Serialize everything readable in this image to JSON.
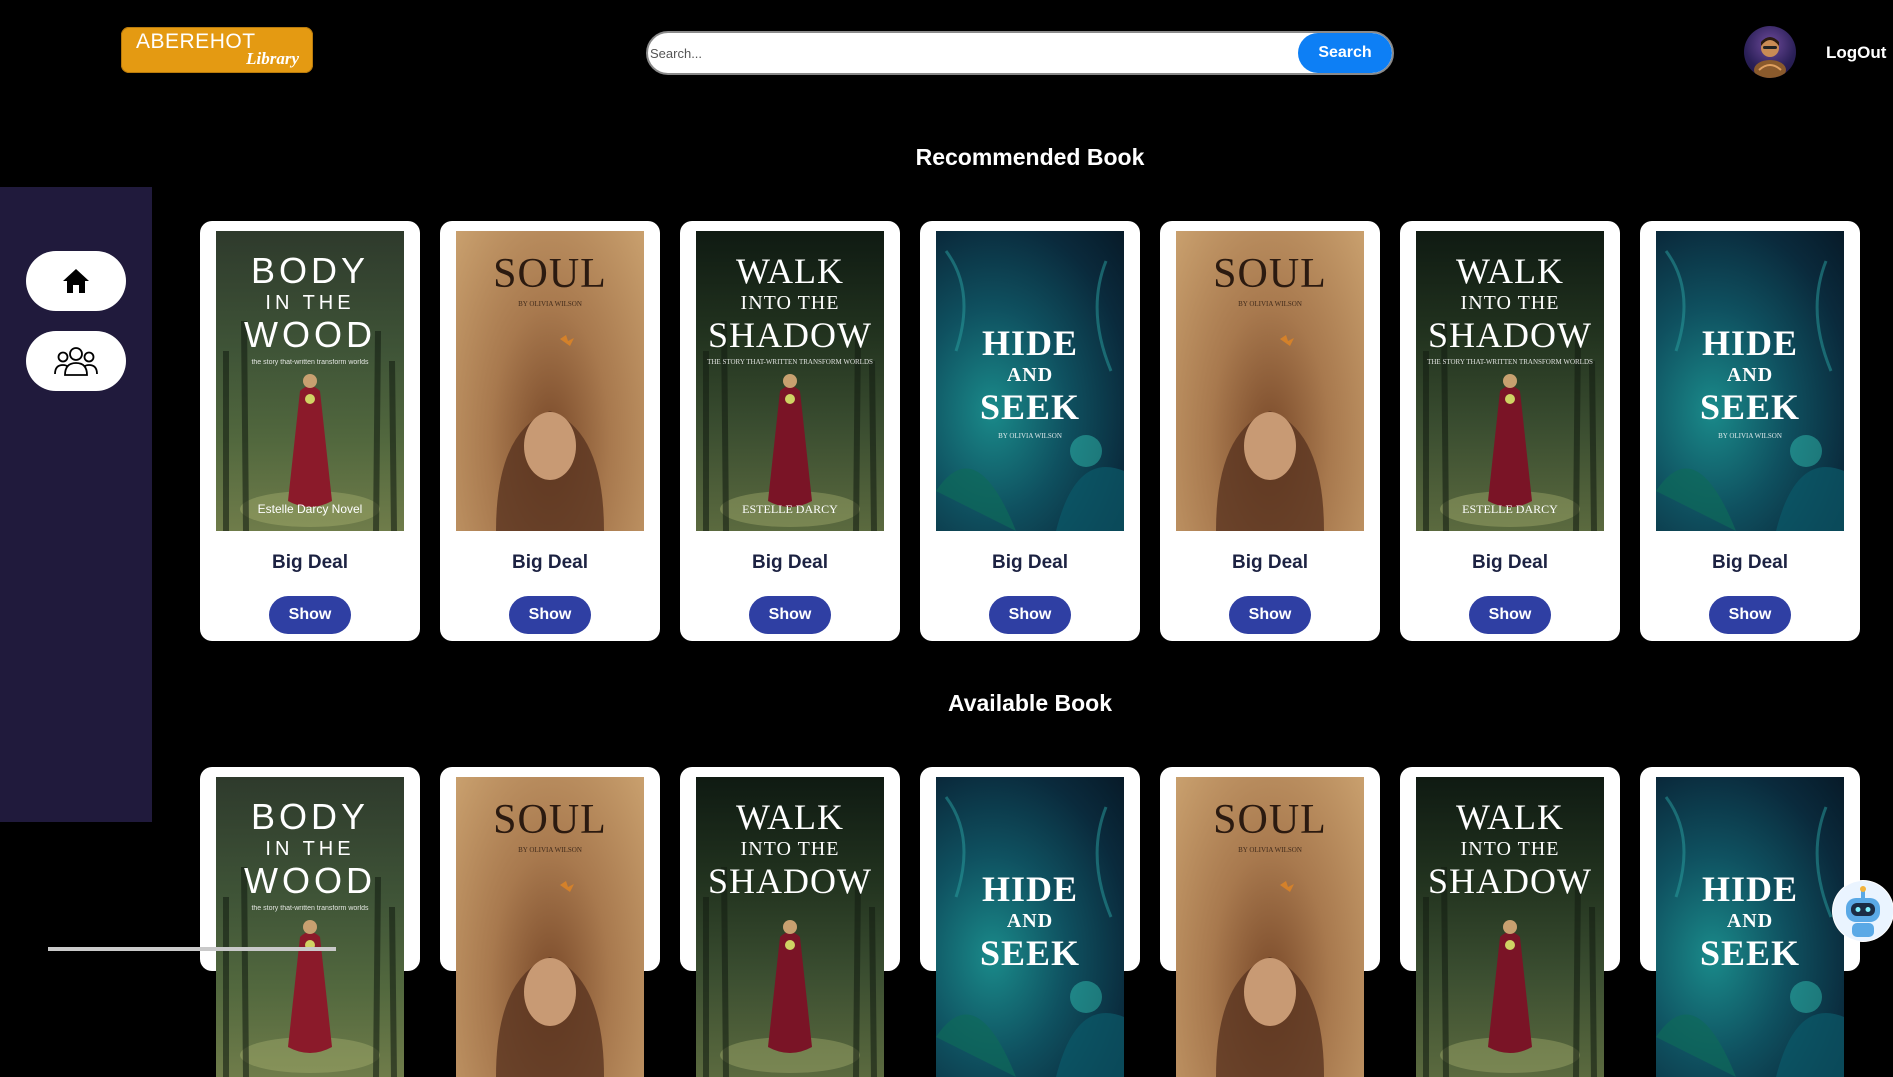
{
  "brand": {
    "top": "ABEREHOT",
    "bottom": "Library"
  },
  "search": {
    "placeholder": "Search...",
    "button": "Search"
  },
  "user": {
    "logout": "LogOut"
  },
  "sidebar": {
    "items": [
      {
        "icon": "home-icon"
      },
      {
        "icon": "users-icon"
      }
    ]
  },
  "sections": {
    "recommended": "Recommended Book",
    "available": "Available Book"
  },
  "recommended_books": [
    {
      "cover_title": [
        "BODY",
        "IN THE",
        "WOOD"
      ],
      "cover_sub": "the story that-written transform worlds",
      "cover_author": "Estelle Darcy Novel",
      "title": "Big Deal",
      "button": "Show"
    },
    {
      "cover_title": [
        "SOUL"
      ],
      "cover_sub": "BY OLIVIA WILSON",
      "cover_author": "",
      "title": "Big Deal",
      "button": "Show"
    },
    {
      "cover_title": [
        "WALK",
        "INTO THE",
        "SHADOW"
      ],
      "cover_sub": "THE STORY THAT-WRITTEN TRANSFORM WORLDS",
      "cover_author": "ESTELLE DARCY",
      "title": "Big Deal",
      "button": "Show"
    },
    {
      "cover_title": [
        "HIDE",
        "AND",
        "SEEK"
      ],
      "cover_sub": "BY OLIVIA WILSON",
      "cover_author": "",
      "title": "Big Deal",
      "button": "Show"
    },
    {
      "cover_title": [
        "SOUL"
      ],
      "cover_sub": "BY OLIVIA WILSON",
      "cover_author": "",
      "title": "Big Deal",
      "button": "Show"
    },
    {
      "cover_title": [
        "WALK",
        "INTO THE",
        "SHADOW"
      ],
      "cover_sub": "THE STORY THAT-WRITTEN TRANSFORM WORLDS",
      "cover_author": "ESTELLE DARCY",
      "title": "Big Deal",
      "button": "Show"
    },
    {
      "cover_title": [
        "HIDE",
        "AND",
        "SEEK"
      ],
      "cover_sub": "BY OLIVIA WILSON",
      "cover_author": "",
      "title": "Big Deal",
      "button": "Show"
    }
  ],
  "available_books": [
    {
      "cover_title": [
        "BODY",
        "IN THE",
        "WOOD"
      ],
      "cover_sub": "the story that-written transform worlds",
      "cover_author": ""
    },
    {
      "cover_title": [
        "SOUL"
      ],
      "cover_sub": "BY OLIVIA WILSON",
      "cover_author": ""
    },
    {
      "cover_title": [
        "WALK",
        "INTO THE",
        "SHADOW"
      ],
      "cover_sub": "",
      "cover_author": ""
    },
    {
      "cover_title": [
        "HIDE",
        "AND",
        "SEEK"
      ],
      "cover_sub": "",
      "cover_author": ""
    },
    {
      "cover_title": [
        "SOUL"
      ],
      "cover_sub": "BY OLIVIA WILSON",
      "cover_author": ""
    },
    {
      "cover_title": [
        "WALK",
        "INTO THE",
        "SHADOW"
      ],
      "cover_sub": "",
      "cover_author": ""
    },
    {
      "cover_title": [
        "HIDE",
        "AND",
        "SEEK"
      ],
      "cover_sub": "",
      "cover_author": ""
    }
  ],
  "colors": {
    "background": "#000000",
    "sidebar": "#201a3c",
    "brand": "#e49a12",
    "search_button": "#0d7ff5",
    "show_button": "#2f3fa3"
  },
  "assistant": {
    "icon": "robot-icon"
  }
}
